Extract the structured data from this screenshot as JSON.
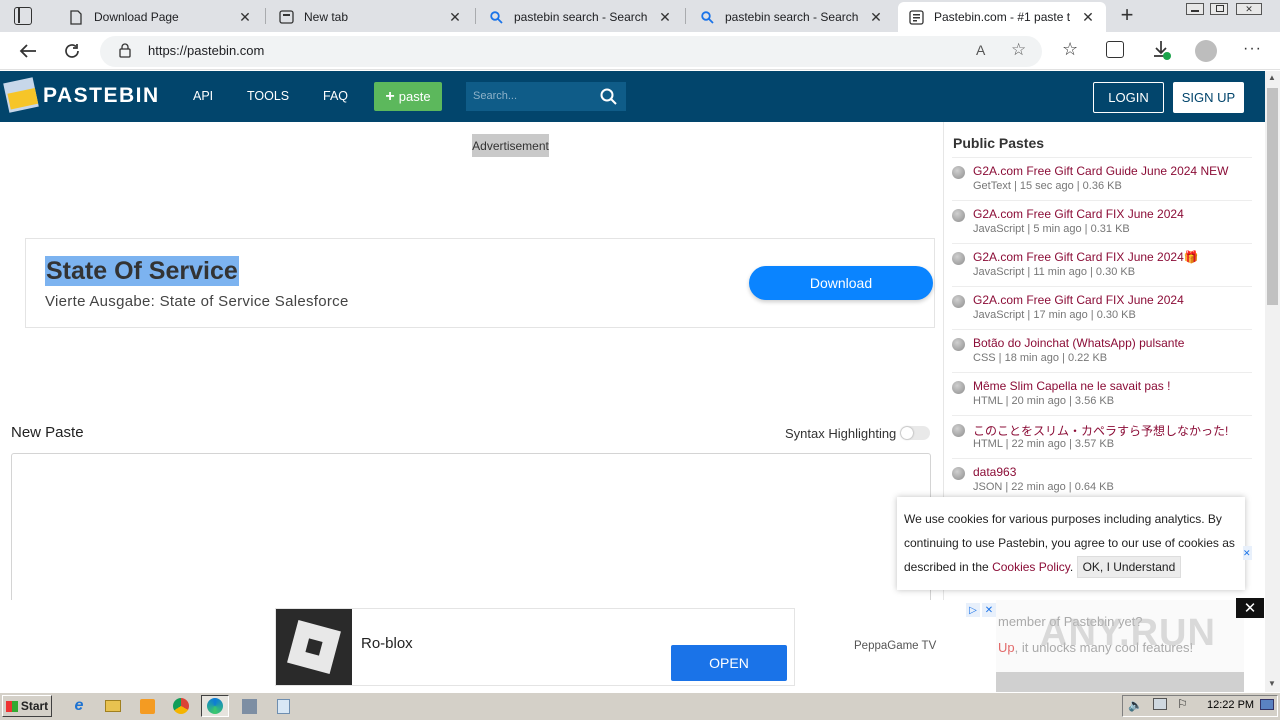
{
  "browser": {
    "tabs": [
      {
        "label": "Download Page",
        "icon": "page-icon"
      },
      {
        "label": "New tab",
        "icon": "newtab-icon"
      },
      {
        "label": "pastebin search - Search",
        "icon": "search-icon"
      },
      {
        "label": "pastebin search - Search",
        "icon": "search-icon"
      },
      {
        "label": "Pastebin.com - #1 paste t",
        "icon": "pastebin-icon",
        "active": true
      }
    ],
    "url": "https://pastebin.com",
    "reader_label": "A"
  },
  "site": {
    "logo_text": "PASTEBIN",
    "nav": [
      "API",
      "TOOLS",
      "FAQ"
    ],
    "paste_button": "paste",
    "search_placeholder": "Search...",
    "login": "LOGIN",
    "signup": "SIGN UP"
  },
  "ad_top": {
    "label": "Advertisement",
    "title": "State Of Service",
    "subtitle": "Vierte Ausgabe: State of Service Salesforce",
    "button": "Download"
  },
  "editor": {
    "heading": "New Paste",
    "syntax_label": "Syntax Highlighting"
  },
  "public_pastes": {
    "heading": "Public Pastes",
    "items": [
      {
        "title": "G2A.com Free Gift Card Guide June 2024 NEW",
        "meta": "GetText | 15 sec ago | 0.36 KB"
      },
      {
        "title": "G2A.com Free Gift Card FIX June 2024",
        "meta": "JavaScript | 5 min ago | 0.31 KB"
      },
      {
        "title": "G2A.com Free Gift Card FIX June 2024🎁",
        "meta": "JavaScript | 11 min ago | 0.30 KB"
      },
      {
        "title": "G2A.com Free Gift Card FIX June 2024",
        "meta": "JavaScript | 17 min ago | 0.30 KB"
      },
      {
        "title": "Botão do Joinchat (WhatsApp) pulsante",
        "meta": "CSS | 18 min ago | 0.22 KB"
      },
      {
        "title": "Même Slim Capella ne le savait pas !",
        "meta": "HTML | 20 min ago | 3.56 KB"
      },
      {
        "title": "このことをスリム・カペラすら予想しなかった!",
        "meta": "HTML | 22 min ago | 3.57 KB"
      },
      {
        "title": "data963",
        "meta": "JSON | 22 min ago | 0.64 KB"
      }
    ]
  },
  "cookie": {
    "text_before": "We use cookies for various purposes including analytics. By continuing to use Pastebin, you agree to our use of cookies as described in the ",
    "link": "Cookies Policy",
    "text_after": ".",
    "button": "OK, I Understand"
  },
  "ad_bottom": {
    "app_name": "Ro-blox",
    "button": "OPEN",
    "publisher": "PeppaGame TV",
    "right_line1": "member of Pastebin yet?",
    "right_line2_link": "Up",
    "right_line2_rest": ", it unlocks many cool features!",
    "watermark": "ANY.RUN"
  },
  "taskbar": {
    "start": "Start",
    "clock": "12:22 PM"
  }
}
